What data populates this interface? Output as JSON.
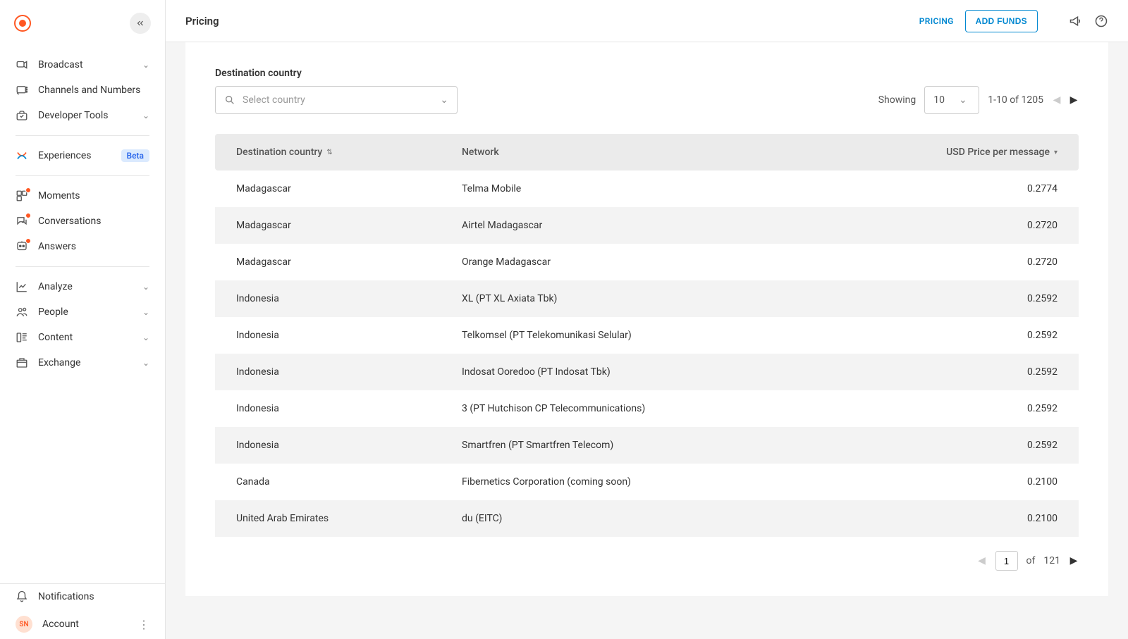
{
  "sidebar": {
    "items": [
      {
        "icon": "arrow-out",
        "label": "Broadcast",
        "chevron": true
      },
      {
        "icon": "chat",
        "label": "Channels and Numbers"
      },
      {
        "icon": "toolbox",
        "label": "Developer Tools",
        "chevron": true
      }
    ],
    "experiences": {
      "label": "Experiences",
      "badge": "Beta"
    },
    "suite": [
      {
        "label": "Moments",
        "dot": true
      },
      {
        "label": "Conversations",
        "dot": true
      },
      {
        "label": "Answers",
        "dot": true
      }
    ],
    "bottomNav": [
      {
        "label": "Analyze",
        "chevron": true
      },
      {
        "label": "People",
        "chevron": true
      },
      {
        "label": "Content",
        "chevron": true
      },
      {
        "label": "Exchange",
        "chevron": true
      }
    ],
    "footer": {
      "notifications": "Notifications",
      "account": "Account",
      "avatar": "SN"
    }
  },
  "header": {
    "title": "Pricing",
    "pricingLink": "PRICING",
    "addFunds": "ADD FUNDS"
  },
  "filter": {
    "label": "Destination country",
    "placeholder": "Select country",
    "showingLabel": "Showing",
    "pageSize": "10",
    "rangeText": "1-10 of 1205"
  },
  "table": {
    "headers": {
      "country": "Destination country",
      "network": "Network",
      "price": "USD Price per message"
    },
    "rows": [
      {
        "country": "Madagascar",
        "network": "Telma Mobile",
        "price": "0.2774"
      },
      {
        "country": "Madagascar",
        "network": "Airtel Madagascar",
        "price": "0.2720"
      },
      {
        "country": "Madagascar",
        "network": "Orange Madagascar",
        "price": "0.2720"
      },
      {
        "country": "Indonesia",
        "network": "XL (PT XL Axiata Tbk)",
        "price": "0.2592"
      },
      {
        "country": "Indonesia",
        "network": "Telkomsel (PT Telekomunikasi Selular)",
        "price": "0.2592"
      },
      {
        "country": "Indonesia",
        "network": "Indosat Ooredoo (PT Indosat Tbk)",
        "price": "0.2592"
      },
      {
        "country": "Indonesia",
        "network": "3 (PT Hutchison CP Telecommunications)",
        "price": "0.2592"
      },
      {
        "country": "Indonesia",
        "network": "Smartfren (PT Smartfren Telecom)",
        "price": "0.2592"
      },
      {
        "country": "Canada",
        "network": "Fibernetics Corporation (coming soon)",
        "price": "0.2100"
      },
      {
        "country": "United Arab Emirates",
        "network": "du (EITC)",
        "price": "0.2100"
      }
    ]
  },
  "pager": {
    "currentPage": "1",
    "ofLabel": "of",
    "totalPages": "121"
  }
}
